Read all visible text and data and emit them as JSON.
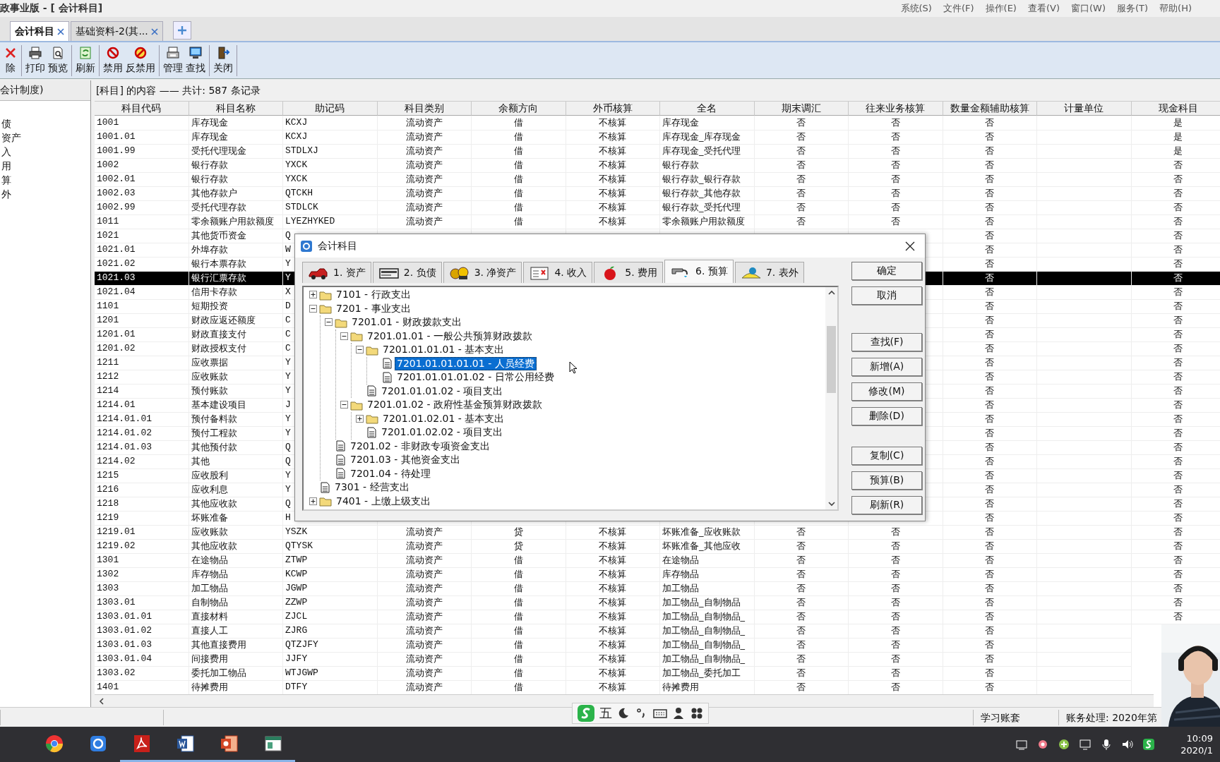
{
  "window": {
    "title": "政事业版 - [ 会计科目]"
  },
  "menu": [
    "系统(S)",
    "文件(F)",
    "操作(E)",
    "查看(V)",
    "窗口(W)",
    "服务(T)",
    "帮助(H)"
  ],
  "doc_tabs": [
    {
      "label": "会计科目",
      "selected": true
    },
    {
      "label": "基础资料-2(其...",
      "selected": false
    }
  ],
  "toolbar": [
    [
      {
        "label": "除",
        "kind": "delete"
      }
    ],
    [
      {
        "label": "打印",
        "kind": "print"
      },
      {
        "label": "预览",
        "kind": "preview"
      }
    ],
    [
      {
        "label": "刷新",
        "kind": "refresh"
      }
    ],
    [
      {
        "label": "禁用",
        "kind": "disable"
      },
      {
        "label": "反禁用",
        "kind": "enable"
      }
    ],
    [
      {
        "label": "管理",
        "kind": "manage"
      },
      {
        "label": "查找",
        "kind": "find"
      }
    ],
    [
      {
        "label": "关闭",
        "kind": "exit"
      }
    ]
  ],
  "sidebar": {
    "header": "会计制度)",
    "items": [
      "债",
      "资产",
      "入",
      "用",
      "算",
      "外"
    ]
  },
  "table": {
    "caption": "[科目] 的内容 —— 共计: 587 条记录",
    "columns": [
      "科目代码",
      "科目名称",
      "助记码",
      "科目类别",
      "余额方向",
      "外币核算",
      "全名",
      "期末调汇",
      "往来业务核算",
      "数量金额辅助核算",
      "计量单位",
      "现金科目"
    ],
    "rows": [
      {
        "cells": [
          "1001",
          "库存现金",
          "KCXJ",
          "流动资产",
          "借",
          "不核算",
          "库存现金",
          "否",
          "否",
          "否",
          null,
          "是"
        ],
        "selected": false
      },
      {
        "cells": [
          "1001.01",
          "库存现金",
          "KCXJ",
          "流动资产",
          "借",
          "不核算",
          "库存现金_库存现金",
          "否",
          "否",
          "否",
          null,
          "是"
        ],
        "selected": false
      },
      {
        "cells": [
          "1001.99",
          "受托代理现金",
          "STDLXJ",
          "流动资产",
          "借",
          "不核算",
          "库存现金_受托代理",
          "否",
          "否",
          "否",
          null,
          "是"
        ],
        "selected": false
      },
      {
        "cells": [
          "1002",
          "银行存款",
          "YXCK",
          "流动资产",
          "借",
          "不核算",
          "银行存款",
          "否",
          "否",
          "否",
          null,
          "否"
        ],
        "selected": false
      },
      {
        "cells": [
          "1002.01",
          "银行存款",
          "YXCK",
          "流动资产",
          "借",
          "不核算",
          "银行存款_银行存款",
          "否",
          "否",
          "否",
          null,
          "否"
        ],
        "selected": false
      },
      {
        "cells": [
          "1002.03",
          "其他存款户",
          "QTCKH",
          "流动资产",
          "借",
          "不核算",
          "银行存款_其他存款",
          "否",
          "否",
          "否",
          null,
          "否"
        ],
        "selected": false
      },
      {
        "cells": [
          "1002.99",
          "受托代理存款",
          "STDLCK",
          "流动资产",
          "借",
          "不核算",
          "银行存款_受托代理",
          "否",
          "否",
          "否",
          null,
          "否"
        ],
        "selected": false
      },
      {
        "cells": [
          "1011",
          "零余额账户用款额度",
          "LYEZHYKED",
          "流动资产",
          "借",
          "不核算",
          "零余额账户用款额度",
          "否",
          "否",
          "否",
          null,
          "否"
        ],
        "selected": false
      },
      {
        "cells": [
          "1021",
          "其他货币资金",
          "Q",
          null,
          null,
          null,
          null,
          null,
          null,
          "否",
          null,
          "否"
        ],
        "selected": false
      },
      {
        "cells": [
          "1021.01",
          "外埠存款",
          "W",
          null,
          null,
          null,
          null,
          null,
          null,
          "否",
          null,
          "否"
        ],
        "selected": false
      },
      {
        "cells": [
          "1021.02",
          "银行本票存款",
          "Y",
          null,
          null,
          null,
          null,
          null,
          null,
          "否",
          null,
          "否"
        ],
        "selected": false
      },
      {
        "cells": [
          "1021.03",
          "银行汇票存款",
          "Y",
          null,
          null,
          null,
          null,
          null,
          null,
          "否",
          null,
          "否"
        ],
        "selected": true
      },
      {
        "cells": [
          "1021.04",
          "信用卡存款",
          "X",
          null,
          null,
          null,
          null,
          null,
          null,
          "否",
          null,
          "否"
        ],
        "selected": false
      },
      {
        "cells": [
          "1101",
          "短期投资",
          "D",
          null,
          null,
          null,
          null,
          null,
          null,
          "否",
          null,
          "否"
        ],
        "selected": false
      },
      {
        "cells": [
          "1201",
          "财政应返还额度",
          "C",
          null,
          null,
          null,
          null,
          null,
          null,
          "否",
          null,
          "否"
        ],
        "selected": false
      },
      {
        "cells": [
          "1201.01",
          "财政直接支付",
          "C",
          null,
          null,
          null,
          null,
          null,
          null,
          "否",
          null,
          "否"
        ],
        "selected": false
      },
      {
        "cells": [
          "1201.02",
          "财政授权支付",
          "C",
          null,
          null,
          null,
          null,
          null,
          null,
          "否",
          null,
          "否"
        ],
        "selected": false
      },
      {
        "cells": [
          "1211",
          "应收票据",
          "Y",
          null,
          null,
          null,
          null,
          null,
          null,
          "否",
          null,
          "否"
        ],
        "selected": false
      },
      {
        "cells": [
          "1212",
          "应收账款",
          "Y",
          null,
          null,
          null,
          null,
          null,
          null,
          "否",
          null,
          "否"
        ],
        "selected": false
      },
      {
        "cells": [
          "1214",
          "预付账款",
          "Y",
          null,
          null,
          null,
          null,
          null,
          null,
          "否",
          null,
          "否"
        ],
        "selected": false
      },
      {
        "cells": [
          "1214.01",
          "基本建设项目",
          "J",
          null,
          null,
          null,
          null,
          null,
          null,
          "否",
          null,
          "否"
        ],
        "selected": false
      },
      {
        "cells": [
          "1214.01.01",
          "预付备料款",
          "Y",
          null,
          null,
          null,
          null,
          null,
          null,
          "否",
          null,
          "否"
        ],
        "selected": false
      },
      {
        "cells": [
          "1214.01.02",
          "预付工程款",
          "Y",
          null,
          null,
          null,
          null,
          null,
          null,
          "否",
          null,
          "否"
        ],
        "selected": false
      },
      {
        "cells": [
          "1214.01.03",
          "其他预付款",
          "Q",
          null,
          null,
          null,
          null,
          null,
          null,
          "否",
          null,
          "否"
        ],
        "selected": false
      },
      {
        "cells": [
          "1214.02",
          "其他",
          "Q",
          null,
          null,
          null,
          null,
          null,
          null,
          "否",
          null,
          "否"
        ],
        "selected": false
      },
      {
        "cells": [
          "1215",
          "应收股利",
          "Y",
          null,
          null,
          null,
          null,
          null,
          null,
          "否",
          null,
          "否"
        ],
        "selected": false
      },
      {
        "cells": [
          "1216",
          "应收利息",
          "Y",
          null,
          null,
          null,
          null,
          null,
          null,
          "否",
          null,
          "否"
        ],
        "selected": false
      },
      {
        "cells": [
          "1218",
          "其他应收款",
          "Q",
          null,
          null,
          null,
          null,
          null,
          null,
          "否",
          null,
          "否"
        ],
        "selected": false
      },
      {
        "cells": [
          "1219",
          "坏账准备",
          "H",
          null,
          null,
          null,
          null,
          null,
          null,
          "否",
          null,
          "否"
        ],
        "selected": false
      },
      {
        "cells": [
          "1219.01",
          "应收账款",
          "YSZK",
          "流动资产",
          "贷",
          "不核算",
          "坏账准备_应收账款",
          "否",
          "否",
          "否",
          null,
          "否"
        ],
        "selected": false
      },
      {
        "cells": [
          "1219.02",
          "其他应收款",
          "QTYSK",
          "流动资产",
          "贷",
          "不核算",
          "坏账准备_其他应收",
          "否",
          "否",
          "否",
          null,
          "否"
        ],
        "selected": false
      },
      {
        "cells": [
          "1301",
          "在途物品",
          "ZTWP",
          "流动资产",
          "借",
          "不核算",
          "在途物品",
          "否",
          "否",
          "否",
          null,
          "否"
        ],
        "selected": false
      },
      {
        "cells": [
          "1302",
          "库存物品",
          "KCWP",
          "流动资产",
          "借",
          "不核算",
          "库存物品",
          "否",
          "否",
          "否",
          null,
          "否"
        ],
        "selected": false
      },
      {
        "cells": [
          "1303",
          "加工物品",
          "JGWP",
          "流动资产",
          "借",
          "不核算",
          "加工物品",
          "否",
          "否",
          "否",
          null,
          "否"
        ],
        "selected": false
      },
      {
        "cells": [
          "1303.01",
          "自制物品",
          "ZZWP",
          "流动资产",
          "借",
          "不核算",
          "加工物品_自制物品",
          "否",
          "否",
          "否",
          null,
          "否"
        ],
        "selected": false
      },
      {
        "cells": [
          "1303.01.01",
          "直接材料",
          "ZJCL",
          "流动资产",
          "借",
          "不核算",
          "加工物品_自制物品_",
          "否",
          "否",
          "否",
          null,
          "否"
        ],
        "selected": false
      },
      {
        "cells": [
          "1303.01.02",
          "直接人工",
          "ZJRG",
          "流动资产",
          "借",
          "不核算",
          "加工物品_自制物品_",
          "否",
          "否",
          "否",
          null,
          null
        ],
        "selected": false
      },
      {
        "cells": [
          "1303.01.03",
          "其他直接费用",
          "QTZJFY",
          "流动资产",
          "借",
          "不核算",
          "加工物品_自制物品_",
          "否",
          "否",
          "否",
          null,
          null
        ],
        "selected": false
      },
      {
        "cells": [
          "1303.01.04",
          "间接费用",
          "JJFY",
          "流动资产",
          "借",
          "不核算",
          "加工物品_自制物品_",
          "否",
          "否",
          "否",
          null,
          null
        ],
        "selected": false
      },
      {
        "cells": [
          "1303.02",
          "委托加工物品",
          "WTJGWP",
          "流动资产",
          "借",
          "不核算",
          "加工物品_委托加工",
          "否",
          "否",
          "否",
          null,
          null
        ],
        "selected": false
      },
      {
        "cells": [
          "1401",
          "待摊费用",
          "DTFY",
          "流动资产",
          "借",
          "不核算",
          "待摊费用",
          "否",
          "否",
          "否",
          null,
          null
        ],
        "selected": false
      }
    ]
  },
  "dialog": {
    "title": "会计科目",
    "tabs": [
      {
        "label": "1. 资产",
        "kind": "car",
        "selected": false
      },
      {
        "label": "2. 负债",
        "kind": "card",
        "selected": false
      },
      {
        "label": "3. 净资产",
        "kind": "coins",
        "selected": false
      },
      {
        "label": "4. 收入",
        "kind": "sheet",
        "selected": false
      },
      {
        "label": "5. 费用",
        "kind": "apple",
        "selected": false
      },
      {
        "label": "6. 预算",
        "kind": "tap",
        "selected": true
      },
      {
        "label": "7. 表外",
        "kind": "lamp",
        "selected": false
      }
    ],
    "tree": [
      {
        "label": "7101 - 行政支出",
        "kind": "folder",
        "expanded": false,
        "selected": false
      },
      {
        "label": "7201 - 事业支出",
        "kind": "folder",
        "expanded": true,
        "selected": false,
        "children": [
          {
            "label": "7201.01 - 财政拨款支出",
            "kind": "folder",
            "expanded": true,
            "selected": false,
            "children": [
              {
                "label": "7201.01.01 - 一般公共预算财政拨款",
                "kind": "folder",
                "expanded": true,
                "selected": false,
                "children": [
                  {
                    "label": "7201.01.01.01 - 基本支出",
                    "kind": "folder",
                    "expanded": true,
                    "selected": false,
                    "children": [
                      {
                        "label": "7201.01.01.01.01 - 人员经费",
                        "kind": "doc",
                        "selected": true
                      },
                      {
                        "label": "7201.01.01.01.02 - 日常公用经费",
                        "kind": "doc",
                        "selected": false
                      }
                    ]
                  },
                  {
                    "label": "7201.01.01.02 - 项目支出",
                    "kind": "doc",
                    "selected": false
                  }
                ]
              },
              {
                "label": "7201.01.02 - 政府性基金预算财政拨款",
                "kind": "folder",
                "expanded": true,
                "selected": false,
                "children": [
                  {
                    "label": "7201.01.02.01 - 基本支出",
                    "kind": "folder",
                    "expanded": false,
                    "selected": false
                  },
                  {
                    "label": "7201.01.02.02 - 项目支出",
                    "kind": "doc",
                    "selected": false
                  }
                ]
              }
            ]
          },
          {
            "label": "7201.02 - 非财政专项资金支出",
            "kind": "doc",
            "selected": false
          },
          {
            "label": "7201.03 - 其他资金支出",
            "kind": "doc",
            "selected": false
          },
          {
            "label": "7201.04 - 待处理",
            "kind": "doc",
            "selected": false
          }
        ]
      },
      {
        "label": "7301 - 经营支出",
        "kind": "doc",
        "selected": false
      },
      {
        "label": "7401 - 上缴上级支出",
        "kind": "folder",
        "expanded": false,
        "selected": false
      }
    ],
    "buttons": [
      [
        "确定",
        "取消"
      ],
      [
        "查找(F)",
        "新增(A)",
        "修改(M)",
        "删除(D)"
      ],
      [
        "复制(C)",
        "预算(B)",
        "刷新(R)"
      ]
    ]
  },
  "status_bar": [
    "学习账套",
    "账务处理: 2020年第"
  ],
  "ime_bar": {
    "mode": "五"
  },
  "webcam": {
    "kind": "picture"
  },
  "taskbar": {
    "apps": [
      {
        "kind": "browser"
      },
      {
        "kind": "camera"
      },
      {
        "kind": "pdf"
      },
      {
        "kind": "word"
      },
      {
        "kind": "slides"
      },
      {
        "kind": "app"
      }
    ],
    "time": "10:09",
    "date": "2020/1"
  }
}
